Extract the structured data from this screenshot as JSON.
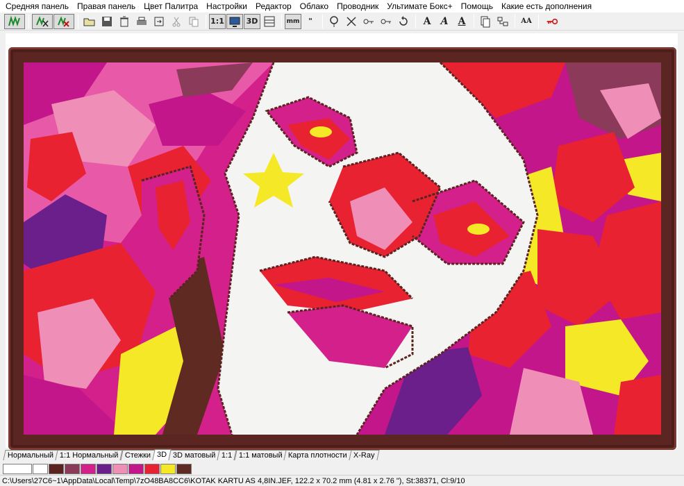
{
  "menu": {
    "items": [
      "Средняя панель",
      "Правая панель",
      "Цвет Палитра",
      "Настройки",
      "Редактор",
      "Облако",
      "Проводник",
      "Ультимате Бокс+",
      "Помощь",
      "Какие есть дополнения"
    ]
  },
  "toolbar": {
    "ratio_label": "1:1",
    "threed_label": "3D",
    "mm_label": "mm",
    "quote_label": "\"",
    "font_a_label": "A",
    "font_aa_label": "AA",
    "icons": [
      "stitch-run-icon",
      "stitch-cut-icon",
      "stitch-erase-icon",
      "open-folder-icon",
      "save-icon",
      "print-icon",
      "copy-icon",
      "cut-icon",
      "paste-icon",
      "ratio-icon",
      "monitor-icon",
      "3d-icon",
      "mm-icon",
      "inch-icon",
      "thread-tool-icon",
      "trim-tool-icon",
      "key-icon",
      "documents-icon",
      "layers-icon",
      "font-icon",
      "lock-key-icon"
    ]
  },
  "tabs": [
    "Нормальный",
    "1:1 Нормальный",
    "Стежки",
    "3D",
    "3D матовый",
    "1:1",
    "1:1 матовый",
    "Карта плотности",
    "X-Ray"
  ],
  "active_tab": "3D",
  "palette": {
    "colors": [
      "#ffffff",
      "#ffffff",
      "#5a2320",
      "#8b3a5a",
      "#d4208a",
      "#6a1f8a",
      "#ef8fb8",
      "#c2168a",
      "#e82230",
      "#f4e827",
      "#5e2a22"
    ]
  },
  "status": {
    "text": "C:\\Users\\27C6~1\\AppData\\Local\\Temp\\7zO48BA8CC6\\KOTAK KARTU AS 4,8IN.JEF, 122.2 x 70.2 mm (4.81 x 2.76 \"), St:38371, Cl:9/10"
  },
  "accent": {
    "hoop": "#5b2522",
    "red": "#e82230",
    "pink": "#d4208a",
    "yellow": "#f4e827"
  }
}
